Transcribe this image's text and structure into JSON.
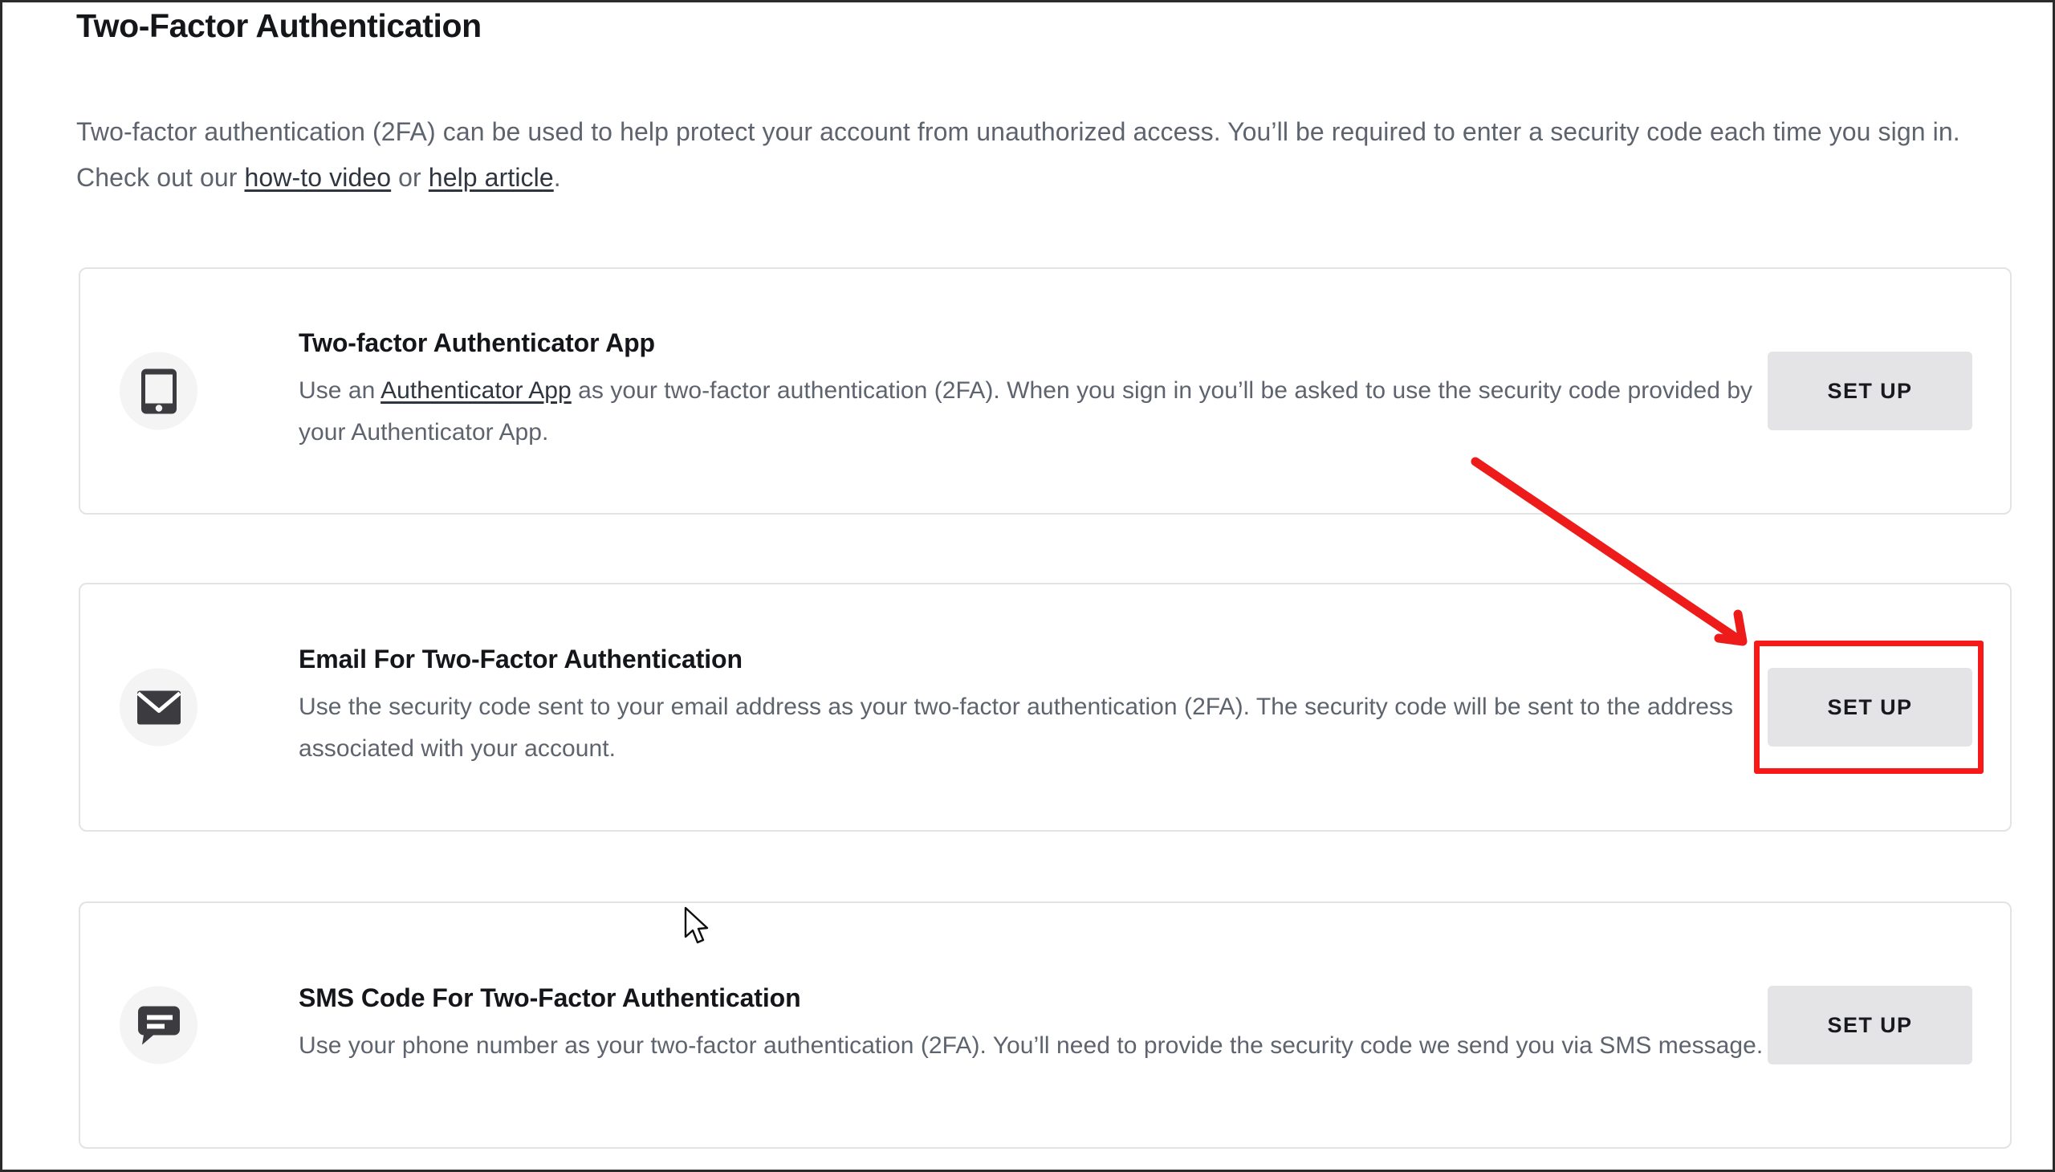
{
  "page": {
    "title": "Two-Factor Authentication",
    "intro": {
      "part1": "Two-factor authentication (2FA) can be used to help protect your account from unauthorized access. You’ll be required to enter a security code each time you sign in. Check out our ",
      "link1": "how-to video",
      "between": " or ",
      "link2": "help article",
      "part2": "."
    }
  },
  "methods": [
    {
      "icon": "phone-icon",
      "title": "Two-factor Authenticator App",
      "desc_part1": "Use an ",
      "desc_link": "Authenticator App",
      "desc_part2": " as your two-factor authentication (2FA). When you sign in you’ll be asked to use the security code provided by your Authenticator App.",
      "button_label": "SET UP"
    },
    {
      "icon": "envelope-icon",
      "title": "Email For Two-Factor Authentication",
      "desc_part1": "Use the security code sent to your email address as your two-factor authentication (2FA). The security code will be sent to the address associated with your account.",
      "desc_link": "",
      "desc_part2": "",
      "button_label": "SET UP"
    },
    {
      "icon": "chat-bubble-icon",
      "title": "SMS Code For Two-Factor Authentication",
      "desc_part1": "Use your phone number as your two-factor authentication (2FA). You’ll need to provide the security code we send you via SMS message.",
      "desc_link": "",
      "desc_part2": "",
      "button_label": "SET UP"
    }
  ],
  "annotations": {
    "highlight_color": "#f81818",
    "arrow_color": "#ee1b1b",
    "highlight_target": "SET UP",
    "arrow_from": "1835,570",
    "arrow_to": "2170,800"
  },
  "colors": {
    "text_primary": "#14161a",
    "text_secondary": "#5e646e",
    "card_border": "#e2e3e5",
    "button_bg": "#e4e4e6",
    "icon_circle_bg": "#f4f4f5",
    "icon_fill": "#3c3c40"
  }
}
